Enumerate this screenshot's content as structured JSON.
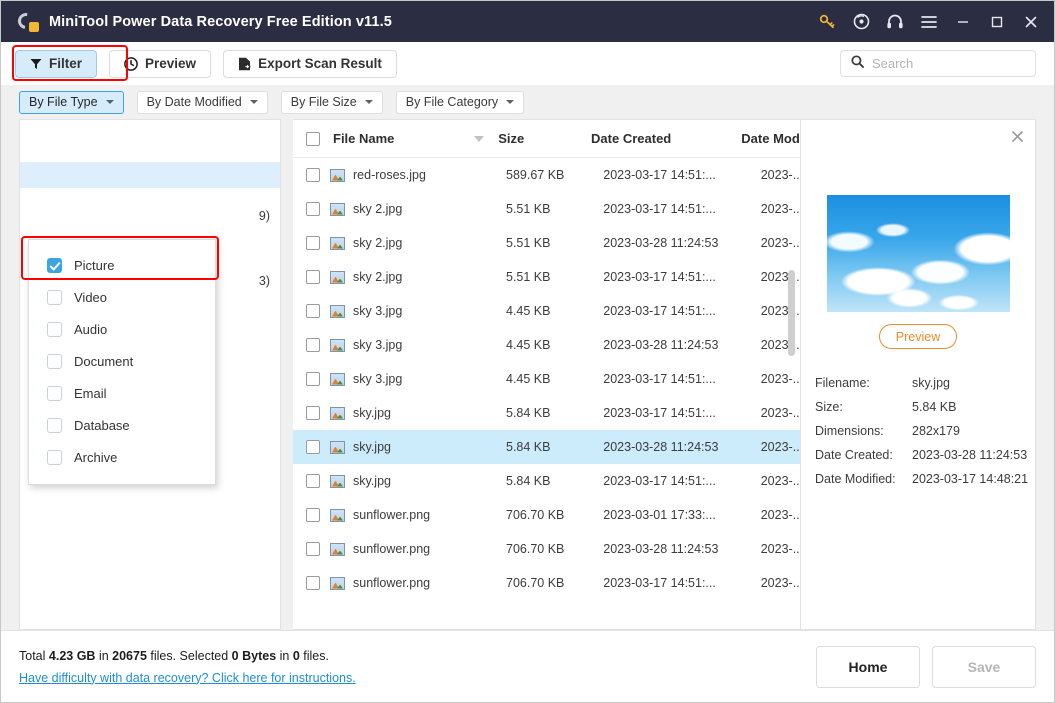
{
  "titlebar": {
    "title": "MiniTool Power Data Recovery Free Edition v11.5",
    "icons": [
      "key-icon",
      "disc-icon",
      "headphones-icon",
      "hamburger-menu-icon",
      "minimize-icon",
      "maximize-icon",
      "close-icon"
    ]
  },
  "toolbar": {
    "filter_label": "Filter",
    "preview_label": "Preview",
    "export_label": "Export Scan Result"
  },
  "search": {
    "value": "",
    "placeholder": "Search"
  },
  "filter_tabs": [
    {
      "label": "By File Type",
      "active": true
    },
    {
      "label": "By Date Modified",
      "active": false
    },
    {
      "label": "By File Size",
      "active": false
    },
    {
      "label": "By File Category",
      "active": false
    }
  ],
  "dropdown": {
    "items": [
      {
        "label": "Picture",
        "checked": true
      },
      {
        "label": "Video",
        "checked": false
      },
      {
        "label": "Audio",
        "checked": false
      },
      {
        "label": "Document",
        "checked": false
      },
      {
        "label": "Email",
        "checked": false
      },
      {
        "label": "Database",
        "checked": false
      },
      {
        "label": "Archive",
        "checked": false
      }
    ]
  },
  "tree_partial": [
    {
      "text": "9)"
    },
    {
      "text": "3)"
    }
  ],
  "table": {
    "headers": {
      "name": "File Name",
      "size": "Size",
      "created": "Date Created",
      "modified": "Date Modif"
    },
    "rows": [
      {
        "name": "red-roses.jpg",
        "size": "589.67 KB",
        "created": "2023-03-17 14:51:...",
        "modified": "2023-...",
        "selected": false
      },
      {
        "name": "sky 2.jpg",
        "size": "5.51 KB",
        "created": "2023-03-17 14:51:...",
        "modified": "2023-...",
        "selected": false
      },
      {
        "name": "sky 2.jpg",
        "size": "5.51 KB",
        "created": "2023-03-28 11:24:53",
        "modified": "2023-...",
        "selected": false
      },
      {
        "name": "sky 2.jpg",
        "size": "5.51 KB",
        "created": "2023-03-17 14:51:...",
        "modified": "2023-...",
        "selected": false
      },
      {
        "name": "sky 3.jpg",
        "size": "4.45 KB",
        "created": "2023-03-17 14:51:...",
        "modified": "2023-...",
        "selected": false
      },
      {
        "name": "sky 3.jpg",
        "size": "4.45 KB",
        "created": "2023-03-28 11:24:53",
        "modified": "2023-...",
        "selected": false
      },
      {
        "name": "sky 3.jpg",
        "size": "4.45 KB",
        "created": "2023-03-17 14:51:...",
        "modified": "2023-...",
        "selected": false
      },
      {
        "name": "sky.jpg",
        "size": "5.84 KB",
        "created": "2023-03-17 14:51:...",
        "modified": "2023-...",
        "selected": false
      },
      {
        "name": "sky.jpg",
        "size": "5.84 KB",
        "created": "2023-03-28 11:24:53",
        "modified": "2023-...",
        "selected": true
      },
      {
        "name": "sky.jpg",
        "size": "5.84 KB",
        "created": "2023-03-17 14:51:...",
        "modified": "2023-...",
        "selected": false
      },
      {
        "name": "sunflower.png",
        "size": "706.70 KB",
        "created": "2023-03-01 17:33:...",
        "modified": "2023-...",
        "selected": false
      },
      {
        "name": "sunflower.png",
        "size": "706.70 KB",
        "created": "2023-03-28 11:24:53",
        "modified": "2023-...",
        "selected": false
      },
      {
        "name": "sunflower.png",
        "size": "706.70 KB",
        "created": "2023-03-17 14:51:...",
        "modified": "2023-...",
        "selected": false
      }
    ]
  },
  "preview": {
    "preview_button": "Preview",
    "meta": [
      {
        "key": "Filename:",
        "value": "sky.jpg"
      },
      {
        "key": "Size:",
        "value": "5.84 KB"
      },
      {
        "key": "Dimensions:",
        "value": "282x179"
      },
      {
        "key": "Date Created:",
        "value": "2023-03-28 11:24:53"
      },
      {
        "key": "Date Modified:",
        "value": "2023-03-17 14:48:21"
      }
    ]
  },
  "footer": {
    "status_prefix": "Total ",
    "total_size": "4.23 GB",
    "status_mid1": " in ",
    "total_files": "20675",
    "status_mid2": " files.  Selected ",
    "selected_size": "0 Bytes",
    "status_mid3": " in ",
    "selected_files": "0",
    "status_suffix": " files.",
    "help_link": "Have difficulty with data recovery? Click here for instructions.",
    "home_label": "Home",
    "save_label": "Save"
  },
  "colors": {
    "titlebar_bg": "#2b2d42",
    "accent_blue": "#3ca5e0",
    "highlight_red": "#ff0000",
    "row_selected": "#ccebfb",
    "preview_orange": "#e98c2d",
    "link_blue": "#1e8fd6"
  }
}
